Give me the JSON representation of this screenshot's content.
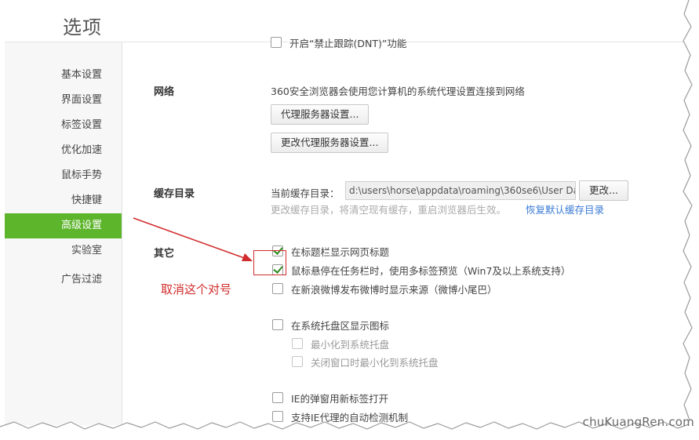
{
  "window": {
    "title": "选项"
  },
  "sidebar": {
    "items": [
      {
        "label": "基本设置"
      },
      {
        "label": "界面设置"
      },
      {
        "label": "标签设置"
      },
      {
        "label": "优化加速"
      },
      {
        "label": "鼠标手势"
      },
      {
        "label": "快捷键"
      },
      {
        "label": "高级设置",
        "active": true
      },
      {
        "label": "实验室"
      },
      {
        "label": "广告过滤"
      }
    ]
  },
  "content": {
    "dnt_partial": "开启“禁止跟踪(DNT)”功能",
    "network": {
      "label": "网络",
      "description": "360安全浏览器会使用您计算机的系统代理设置连接到网络",
      "proxy_button": "代理服务器设置...",
      "change_proxy_button": "更改代理服务器设置..."
    },
    "cache": {
      "label": "缓存目录",
      "current_label": "当前缓存目录：",
      "path_value": "d:\\users\\horse\\appdata\\roaming\\360se6\\User Da",
      "change_button": "更改...",
      "hint": "更改缓存目录，将清空现有缓存，重启浏览器后生效。",
      "restore_link": "恢复默认缓存目录"
    },
    "other": {
      "label": "其它",
      "options": [
        {
          "label": "在标题栏显示网页标题",
          "checked": true
        },
        {
          "label": "鼠标悬停在任务栏时，使用多标签预览（Win7及以上系统支持）",
          "checked": true
        },
        {
          "label": "在新浪微博发布微博时显示来源（微博小尾巴）",
          "checked": false
        },
        {
          "label": "在系统托盘区显示图标",
          "checked": false
        },
        {
          "label": "最小化到系统托盘",
          "checked": false,
          "disabled": true
        },
        {
          "label": "关闭窗口时最小化到系统托盘",
          "checked": false,
          "disabled": true
        },
        {
          "label": "IE的弹窗用新标签打开",
          "checked": false
        },
        {
          "label": "支持IE代理的自动检测机制",
          "checked": false
        }
      ]
    }
  },
  "annotation": {
    "text": "取消这个对号",
    "color": "#d12b2b"
  },
  "watermark": "chuKuangRen.com",
  "colors": {
    "accent": "#5db52c",
    "link": "#3a7bd5"
  }
}
